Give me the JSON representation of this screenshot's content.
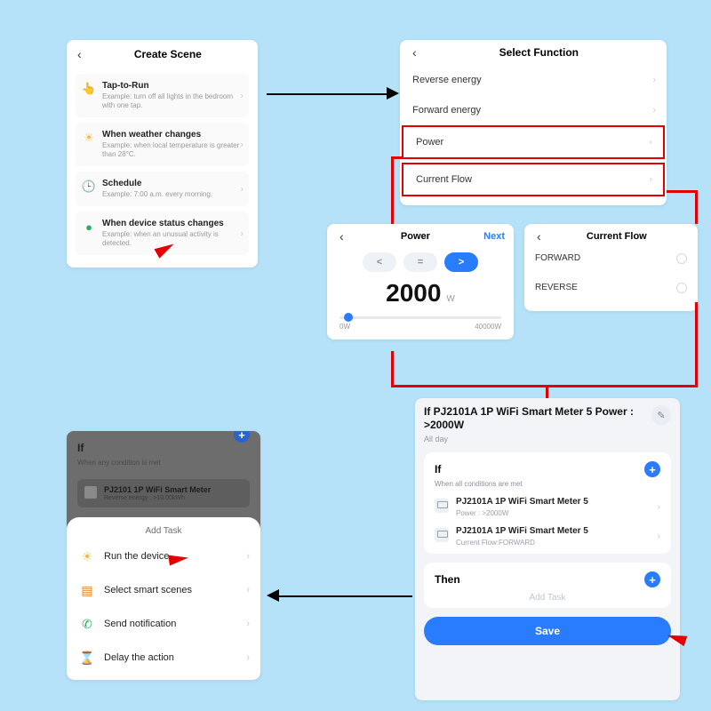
{
  "create_scene": {
    "title": "Create Scene",
    "items": [
      {
        "title": "Tap-to-Run",
        "subtitle": "Example: turn off all lights in the bedroom with one tap."
      },
      {
        "title": "When weather changes",
        "subtitle": "Example: when local temperature is greater than 28°C."
      },
      {
        "title": "Schedule",
        "subtitle": "Example: 7:00 a.m. every morning."
      },
      {
        "title": "When device status changes",
        "subtitle": "Example: when an unusual activity is detected."
      }
    ]
  },
  "select_function": {
    "title": "Select Function",
    "rows": [
      "Reverse energy",
      "Forward energy",
      "Power",
      "Current Flow"
    ]
  },
  "power": {
    "title": "Power",
    "next": "Next",
    "ops": {
      "lt": "<",
      "eq": "=",
      "gt": ">"
    },
    "value": "2000",
    "unit": "W",
    "range_min": "0W",
    "range_max": "40000W"
  },
  "current_flow": {
    "title": "Current Flow",
    "options": [
      "FORWARD",
      "REVERSE"
    ]
  },
  "scene": {
    "title": "If PJ2101A 1P WiFi Smart Meter  5 Power : >2000W",
    "subtitle": "All day",
    "if_label": "If",
    "if_sub": "When all conditions are met",
    "conditions": [
      {
        "name": "PJ2101A 1P WiFi Smart Meter 5",
        "detail": "Power : >2000W"
      },
      {
        "name": "PJ2101A 1P WiFi Smart Meter 5",
        "detail": "Current Flow:FORWARD"
      }
    ],
    "then_label": "Then",
    "add_task": "Add Task",
    "save": "Save"
  },
  "task_panel": {
    "if_label": "If",
    "if_sub": "When any condition is met",
    "cond_name": "PJ2101 1P WiFi Smart Meter",
    "cond_detail": "Reverse energy : >10.00kWh",
    "sheet_title": "Add Task",
    "rows": [
      "Run the device",
      "Select smart scenes",
      "Send notification",
      "Delay the action"
    ]
  }
}
